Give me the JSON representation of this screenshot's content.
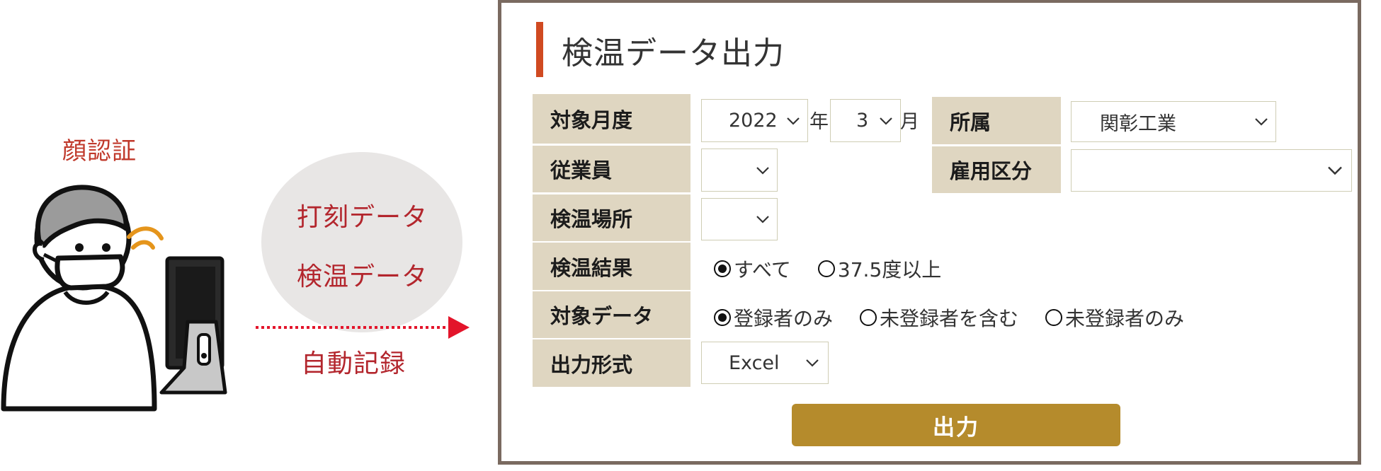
{
  "illustration": {
    "face_caption": "顔認証",
    "bubble_lines": [
      "打刻データ",
      "検温データ"
    ],
    "arrow_caption": "自動記録",
    "accent_color": "#b3262d",
    "icons": [
      "person-with-mask-icon",
      "face-terminal-icon",
      "signal-waves-icon",
      "right-arrow-icon"
    ]
  },
  "form": {
    "title": "検温データ出力",
    "labels": {
      "month": "対象月度",
      "department": "所属",
      "employee": "従業員",
      "employment_type": "雇用区分",
      "location": "検温場所",
      "result": "検温結果",
      "target": "対象データ",
      "format": "出力形式"
    },
    "year_select": {
      "value": "2022",
      "unit": "年"
    },
    "month_select": {
      "value": "3",
      "unit": "月"
    },
    "department_select": {
      "value": "関彰工業"
    },
    "employee_select": {
      "value": ""
    },
    "employment_type_select": {
      "value": ""
    },
    "location_select": {
      "value": ""
    },
    "result_options": [
      {
        "label": "すべて",
        "selected": true
      },
      {
        "label": "37.5度以上",
        "selected": false
      }
    ],
    "target_options": [
      {
        "label": "登録者のみ",
        "selected": true
      },
      {
        "label": "未登録者を含む",
        "selected": false
      },
      {
        "label": "未登録者のみ",
        "selected": false
      }
    ],
    "format_select": {
      "value": "Excel"
    },
    "submit_label": "出力",
    "colors": {
      "label_bg": "#dfd6c1",
      "title_accent": "#d04a21",
      "button_bg": "#b58b2c",
      "panel_border": "#7a6a60"
    }
  }
}
